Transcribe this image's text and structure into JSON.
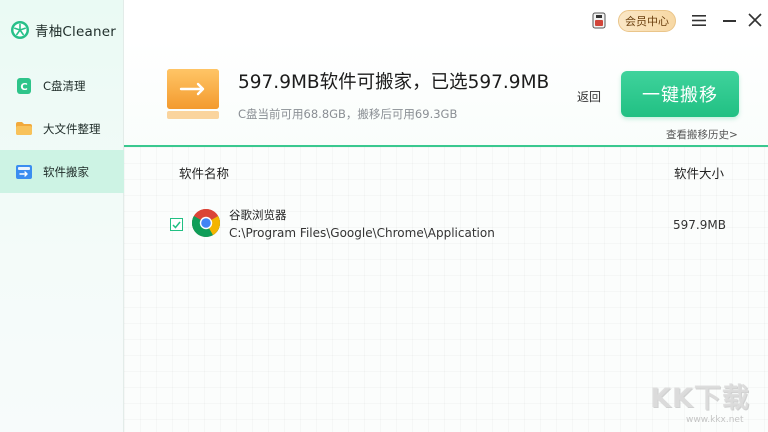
{
  "app": {
    "name": "青柚Cleaner"
  },
  "sidebar": {
    "items": [
      {
        "label": "C盘清理",
        "icon": "c-drive-icon",
        "active": false
      },
      {
        "label": "大文件整理",
        "icon": "folder-icon",
        "active": false
      },
      {
        "label": "软件搬家",
        "icon": "software-move-icon",
        "active": true
      }
    ]
  },
  "topbar": {
    "vip_label": "会员中心"
  },
  "header": {
    "headline": "597.9MB软件可搬家，已选597.9MB",
    "subline": "C盘当前可用68.8GB，搬移后可用69.3GB",
    "back_label": "返回",
    "primary_label": "一键搬移",
    "history_label": "查看搬移历史>"
  },
  "table": {
    "columns": {
      "name": "软件名称",
      "size": "软件大小"
    },
    "rows": [
      {
        "name": "谷歌浏览器",
        "path": "C:\\Program Files\\Google\\Chrome\\Application",
        "size": "597.9MB",
        "checked": true
      }
    ]
  },
  "watermark": {
    "logo": "KK下载",
    "url": "www.kkx.net"
  },
  "colors": {
    "accent": "#21c083",
    "active_bg": "#cdf3e4",
    "vip_bg": "#f7d8a4"
  }
}
